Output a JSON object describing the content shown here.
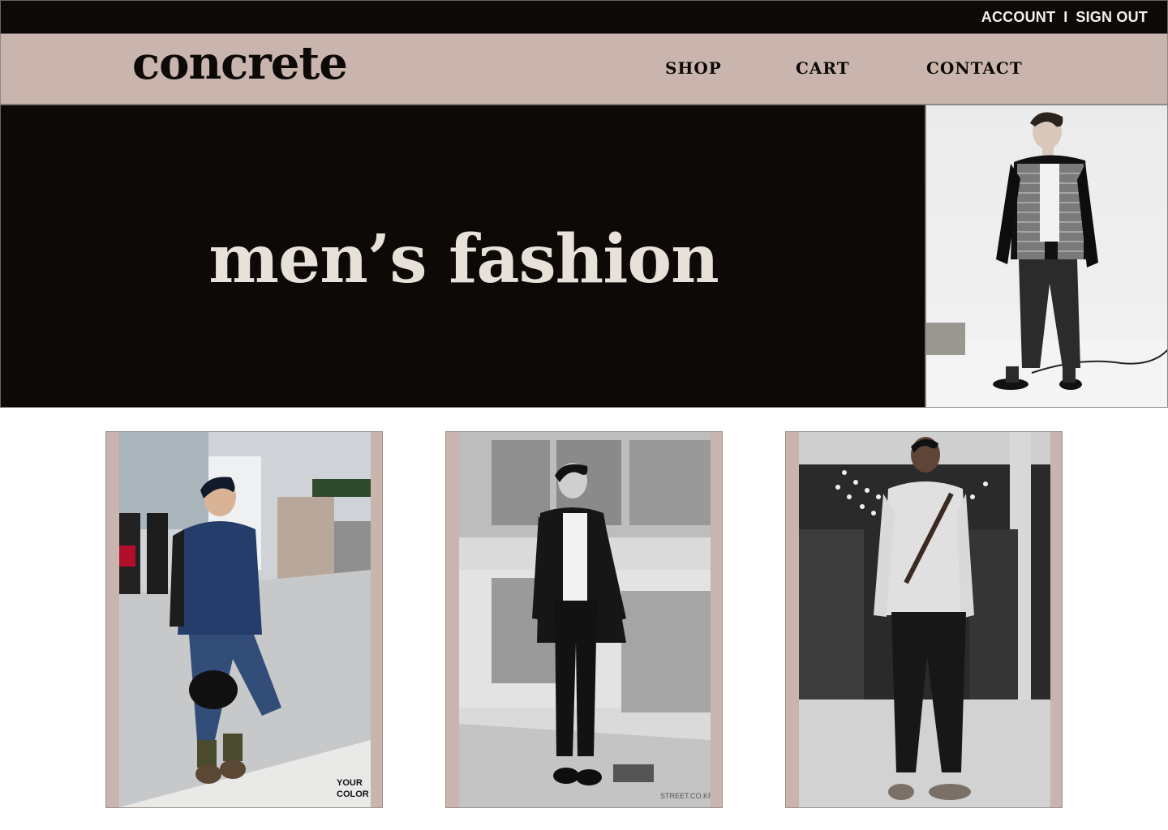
{
  "utility_bar": {
    "account_label": "ACCOUNT",
    "separator": "I",
    "signout_label": "SIGN OUT"
  },
  "header": {
    "logo": "concrete",
    "nav": [
      "SHOP",
      "CART",
      "CONTACT"
    ]
  },
  "hero": {
    "title": "men’s fashion",
    "photo": "model-bomber-jacket-photo"
  },
  "products": [
    {
      "photo": "street-style-denim-photo",
      "watermark_line1": "YOUR",
      "watermark_line2": "COLOR"
    },
    {
      "photo": "street-style-black-shirt-photo",
      "watermark": "STREET.CO.KR"
    },
    {
      "photo": "mall-grey-sweater-photo"
    }
  ],
  "colors": {
    "dark": "#0c0907",
    "taupe": "#c9b5ad",
    "cream": "#e8e1d9",
    "white": "#ffffff"
  }
}
